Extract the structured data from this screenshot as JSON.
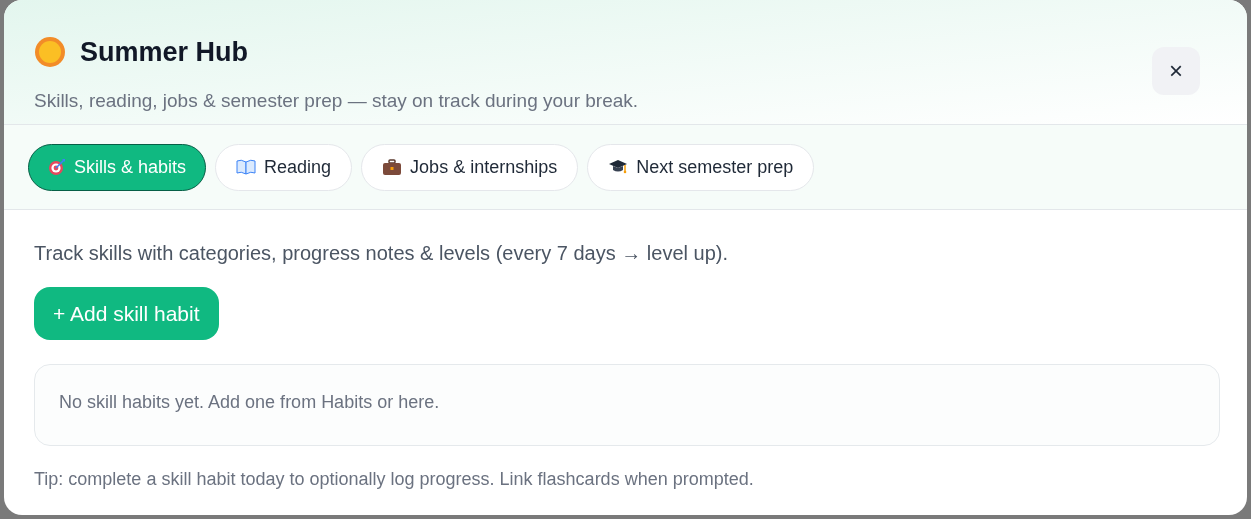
{
  "modal": {
    "title": "Summer Hub",
    "subtitle": "Skills, reading, jobs & semester prep — stay on track during your break.",
    "close": "×"
  },
  "tabs": [
    {
      "label": "Skills & habits",
      "kind": "target",
      "selected": true
    },
    {
      "label": "Reading",
      "kind": "book",
      "selected": false
    },
    {
      "label": "Jobs & internships",
      "kind": "briefcase",
      "selected": false
    },
    {
      "label": "Next semester prep",
      "kind": "cap",
      "selected": false
    }
  ],
  "panel": {
    "intro": "Track skills with categories, progress notes & levels (every 7 days → level up).",
    "add_button": "+ Add skill habit",
    "empty_message": "No skill habits yet. Add one from Habits or here.",
    "tip": "Tip: complete a skill habit today to optionally log progress. Link flashcards when prompted."
  }
}
